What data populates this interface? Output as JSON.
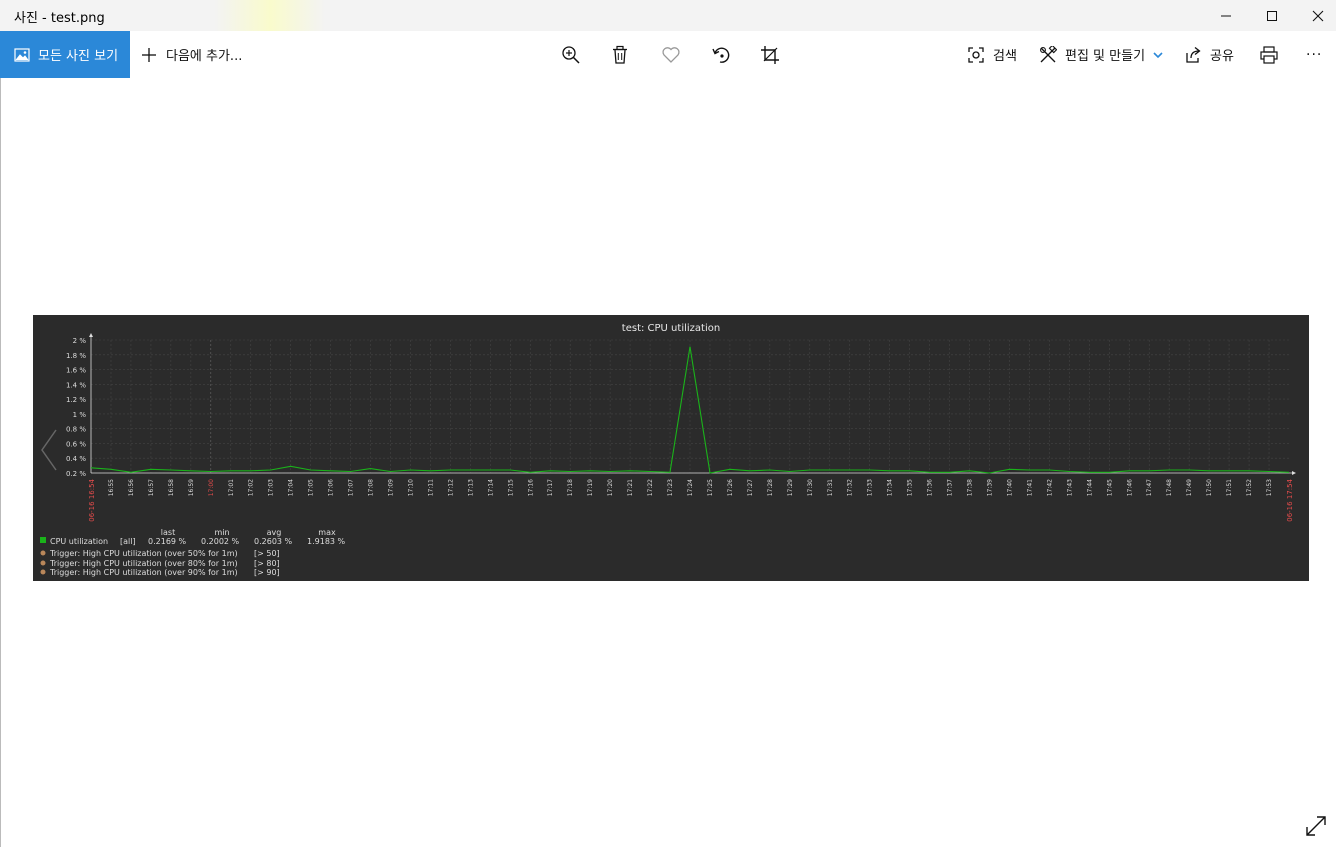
{
  "window": {
    "title": "사진 - test.png"
  },
  "toolbar": {
    "all_photos_label": "모든 사진 보기",
    "add_to_label": "다음에 추가...",
    "search_label": "검색",
    "edit_create_label": "편집 및 만들기",
    "share_label": "공유",
    "more_label": "···"
  },
  "colors": {
    "accent": "#2b88d8",
    "graph_bg": "#2b2b2b",
    "series": "#1ab31a",
    "trigger": "#b9875a",
    "time_red": "#e74c4c"
  },
  "chart_data": {
    "type": "line",
    "title": "test: CPU utilization",
    "y_ticks": [
      "2 %",
      "1.8 %",
      "1.6 %",
      "1.4 %",
      "1.2 %",
      "1 %",
      "0.8 %",
      "0.6 %",
      "0.4 %",
      "0.2 %"
    ],
    "ylim": [
      0.2,
      2.0
    ],
    "x_start_label": "06-16 16:54",
    "x_end_label": "06-16 17:54",
    "x_ticks": [
      "16:55",
      "16:56",
      "16:57",
      "16:58",
      "16:59",
      "17:00",
      "17:01",
      "17:02",
      "17:03",
      "17:04",
      "17:05",
      "17:06",
      "17:07",
      "17:08",
      "17:09",
      "17:10",
      "17:11",
      "17:12",
      "17:13",
      "17:14",
      "17:15",
      "17:16",
      "17:17",
      "17:18",
      "17:19",
      "17:20",
      "17:21",
      "17:22",
      "17:23",
      "17:24",
      "17:25",
      "17:26",
      "17:27",
      "17:28",
      "17:29",
      "17:30",
      "17:31",
      "17:32",
      "17:33",
      "17:34",
      "17:35",
      "17:36",
      "17:37",
      "17:38",
      "17:39",
      "17:40",
      "17:41",
      "17:42",
      "17:43",
      "17:44",
      "17:45",
      "17:46",
      "17:47",
      "17:48",
      "17:49",
      "17:50",
      "17:51",
      "17:52",
      "17:53"
    ],
    "series": [
      {
        "name": "CPU utilization",
        "values": [
          0.27,
          0.25,
          0.21,
          0.25,
          0.24,
          0.23,
          0.22,
          0.23,
          0.23,
          0.24,
          0.29,
          0.24,
          0.23,
          0.22,
          0.26,
          0.22,
          0.24,
          0.23,
          0.24,
          0.24,
          0.24,
          0.24,
          0.21,
          0.23,
          0.22,
          0.23,
          0.22,
          0.23,
          0.22,
          0.21,
          1.91,
          0.2,
          0.25,
          0.23,
          0.24,
          0.22,
          0.24,
          0.24,
          0.24,
          0.24,
          0.23,
          0.23,
          0.21,
          0.21,
          0.23,
          0.2,
          0.25,
          0.24,
          0.24,
          0.22,
          0.21,
          0.21,
          0.23,
          0.23,
          0.24,
          0.24,
          0.23,
          0.23,
          0.23,
          0.22,
          0.21
        ]
      }
    ],
    "legend": {
      "headers": {
        "last": "last",
        "min": "min",
        "avg": "avg",
        "max": "max"
      },
      "series_label": "CPU utilization",
      "func": "[all]",
      "last": "0.2169 %",
      "min": "0.2002 %",
      "avg": "0.2603 %",
      "max": "1.9183 %",
      "triggers": [
        {
          "label": "Trigger: High CPU utilization (over 50% for 1m)",
          "cond": "[> 50]"
        },
        {
          "label": "Trigger: High CPU utilization (over 80% for 1m)",
          "cond": "[> 80]"
        },
        {
          "label": "Trigger: High CPU utilization (over 90% for 1m)",
          "cond": "[> 90]"
        }
      ]
    }
  }
}
